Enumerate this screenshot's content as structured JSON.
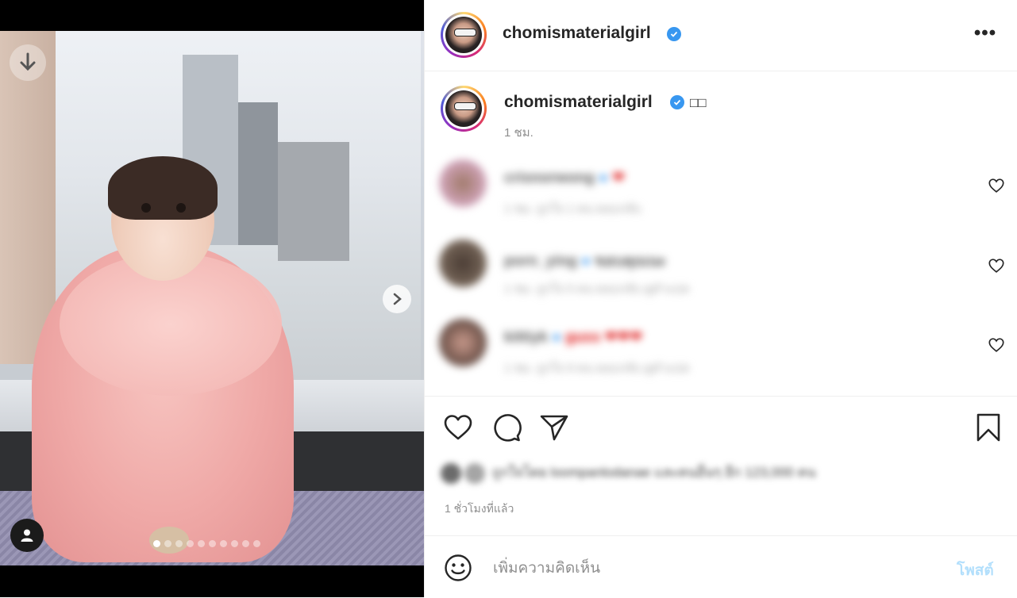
{
  "post": {
    "username": "chomismaterialgirl",
    "verified_icon": "verified-badge-icon",
    "more_icon": "more-options-icon",
    "more_label": "•••"
  },
  "caption": {
    "username": "chomismaterialgirl",
    "text": "□□",
    "time": "1 ชม."
  },
  "comments": [
    {
      "username": "crisnorwong",
      "text": "❤",
      "meta": "1 ชม.  ถูกใจ 1 คน  ตอบกลับ"
    },
    {
      "username": "porn_ying",
      "text": "ขอบคุณนะ",
      "meta": "1 ชม.  ถูกใจ 5 คน  ตอบกลับ  ดูคำแปล"
    },
    {
      "username": "kittiyk",
      "text": "guss ❤❤❤",
      "meta": "1 ชม.  ถูกใจ 9 คน  ตอบกลับ  ดูคำแปล"
    }
  ],
  "actions": {
    "likes_text": "ถูกใจโดย loompanlodanae และคนอื่นๆ อีก 123,000 คน",
    "timestamp": "1 ชั่วโมงที่แล้ว"
  },
  "composer": {
    "placeholder": "เพิ่มความคิดเห็น",
    "post_label": "โพสต์"
  },
  "carousel": {
    "count": 10,
    "active": 1
  },
  "colors": {
    "accent": "#3897f0",
    "post_disabled": "#b2dffc",
    "heart": "#ed4956"
  }
}
